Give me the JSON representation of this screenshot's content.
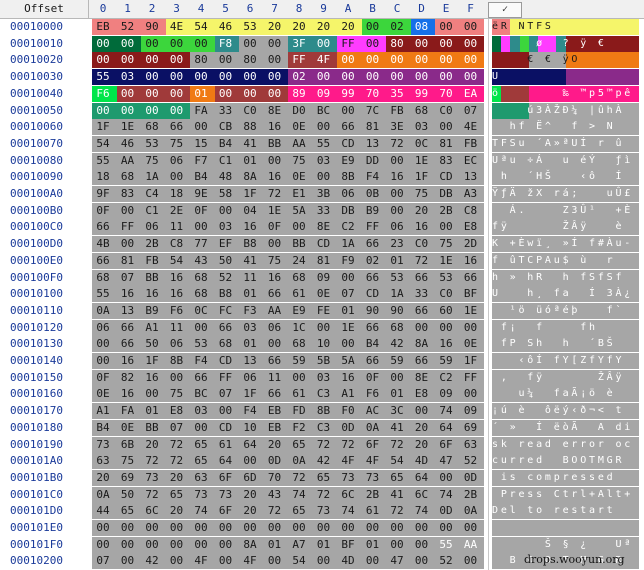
{
  "header": {
    "offset_label": "Offset",
    "columns": [
      "0",
      "1",
      "2",
      "3",
      "4",
      "5",
      "6",
      "7",
      "8",
      "9",
      "A",
      "B",
      "C",
      "D",
      "E",
      "F"
    ],
    "text_icon": "checkmark-icon"
  },
  "colors": {
    "default": "#a6a6a6",
    "red": "#f08080",
    "yellow": "#f5f56a",
    "green": "#3cd63c",
    "blue": "#1670e8",
    "darkgreen": "#006b3a",
    "teal": "#2e8b8b",
    "magenta": "#ff3cff",
    "maroon": "#8a1a1a",
    "brown": "#a03a3a",
    "orange": "#f07a14",
    "purple": "#8a2a8a",
    "navy": "#0a1064",
    "lime": "#00e64a",
    "pink": "#ff1a8a",
    "sea": "#1e9a6e"
  },
  "rows": [
    {
      "offset": "00010000",
      "hex": [
        "EB",
        "52",
        "90",
        "4E",
        "54",
        "46",
        "53",
        "20",
        "20",
        "20",
        "20",
        "00",
        "02",
        "08",
        "00",
        "00"
      ],
      "ascii": "ëR NTFS         "
    },
    {
      "offset": "00010010",
      "hex": [
        "00",
        "00",
        "00",
        "00",
        "00",
        "F8",
        "00",
        "00",
        "3F",
        "00",
        "FF",
        "00",
        "80",
        "00",
        "00",
        "00"
      ],
      "ascii": "     ø  ? ÿ €   "
    },
    {
      "offset": "00010020",
      "hex": [
        "00",
        "00",
        "00",
        "00",
        "80",
        "00",
        "80",
        "00",
        "FF",
        "4F",
        "00",
        "00",
        "00",
        "00",
        "00",
        "00"
      ],
      "ascii": "    € € ÿO      "
    },
    {
      "offset": "00010030",
      "hex": [
        "55",
        "03",
        "00",
        "00",
        "00",
        "00",
        "00",
        "00",
        "02",
        "00",
        "00",
        "00",
        "00",
        "00",
        "00",
        "00"
      ],
      "ascii": "U               "
    },
    {
      "offset": "00010040",
      "hex": [
        "F6",
        "00",
        "00",
        "00",
        "01",
        "00",
        "00",
        "00",
        "89",
        "09",
        "99",
        "70",
        "35",
        "99",
        "70",
        "EA"
      ],
      "ascii": "ö       ‰ ™p5™pê"
    },
    {
      "offset": "00010050",
      "hex": [
        "00",
        "00",
        "00",
        "00",
        "FA",
        "33",
        "C0",
        "8E",
        "D0",
        "BC",
        "00",
        "7C",
        "FB",
        "68",
        "C0",
        "07"
      ],
      "ascii": "    ú3ÀŽÐ¼ |ûhÀ "
    },
    {
      "offset": "00010060",
      "hex": [
        "1F",
        "1E",
        "68",
        "66",
        "00",
        "CB",
        "88",
        "16",
        "0E",
        "00",
        "66",
        "81",
        "3E",
        "03",
        "00",
        "4E"
      ],
      "ascii": "  hf Ë^  f > N"
    },
    {
      "offset": "00010070",
      "hex": [
        "54",
        "46",
        "53",
        "75",
        "15",
        "B4",
        "41",
        "BB",
        "AA",
        "55",
        "CD",
        "13",
        "72",
        "0C",
        "81",
        "FB"
      ],
      "ascii": "TFSu ´A»ªUÍ r û"
    },
    {
      "offset": "00010080",
      "hex": [
        "55",
        "AA",
        "75",
        "06",
        "F7",
        "C1",
        "01",
        "00",
        "75",
        "03",
        "E9",
        "DD",
        "00",
        "1E",
        "83",
        "EC"
      ],
      "ascii": "Uªu ÷Á  u éÝ  ƒì"
    },
    {
      "offset": "00010090",
      "hex": [
        "18",
        "68",
        "1A",
        "00",
        "B4",
        "48",
        "8A",
        "16",
        "0E",
        "00",
        "8B",
        "F4",
        "16",
        "1F",
        "CD",
        "13"
      ],
      "ascii": " h  ´HŠ   ‹ô  Í"
    },
    {
      "offset": "000100A0",
      "hex": [
        "9F",
        "83",
        "C4",
        "18",
        "9E",
        "58",
        "1F",
        "72",
        "E1",
        "3B",
        "06",
        "0B",
        "00",
        "75",
        "DB",
        "A3"
      ],
      "ascii": "ŸƒÄ žX rá;   uÛ£"
    },
    {
      "offset": "000100B0",
      "hex": [
        "0F",
        "00",
        "C1",
        "2E",
        "0F",
        "00",
        "04",
        "1E",
        "5A",
        "33",
        "DB",
        "B9",
        "00",
        "20",
        "2B",
        "C8"
      ],
      "ascii": "  Á.    Z3Û¹  +È"
    },
    {
      "offset": "000100C0",
      "hex": [
        "66",
        "FF",
        "06",
        "11",
        "00",
        "03",
        "16",
        "0F",
        "00",
        "8E",
        "C2",
        "FF",
        "06",
        "16",
        "00",
        "E8"
      ],
      "ascii": "fÿ      ŽÂÿ   è"
    },
    {
      "offset": "000100D0",
      "hex": [
        "4B",
        "00",
        "2B",
        "C8",
        "77",
        "EF",
        "B8",
        "00",
        "BB",
        "CD",
        "1A",
        "66",
        "23",
        "C0",
        "75",
        "2D"
      ],
      "ascii": "K +Èwï¸ »Í f#Àu-"
    },
    {
      "offset": "000100E0",
      "hex": [
        "66",
        "81",
        "FB",
        "54",
        "43",
        "50",
        "41",
        "75",
        "24",
        "81",
        "F9",
        "02",
        "01",
        "72",
        "1E",
        "16"
      ],
      "ascii": "f ûTCPAu$ ù  r  "
    },
    {
      "offset": "000100F0",
      "hex": [
        "68",
        "07",
        "BB",
        "16",
        "68",
        "52",
        "11",
        "16",
        "68",
        "09",
        "00",
        "66",
        "53",
        "66",
        "53",
        "66"
      ],
      "ascii": "h » hR  h fSfSf"
    },
    {
      "offset": "00010100",
      "hex": [
        "55",
        "16",
        "16",
        "16",
        "68",
        "B8",
        "01",
        "66",
        "61",
        "0E",
        "07",
        "CD",
        "1A",
        "33",
        "C0",
        "BF"
      ],
      "ascii": "U   h¸ fa  Í 3À¿"
    },
    {
      "offset": "00010110",
      "hex": [
        "0A",
        "13",
        "B9",
        "F6",
        "0C",
        "FC",
        "F3",
        "AA",
        "E9",
        "FE",
        "01",
        "90",
        "90",
        "66",
        "60",
        "1E"
      ],
      "ascii": "  ¹ö üóªéþ   f` "
    },
    {
      "offset": "00010120",
      "hex": [
        "06",
        "66",
        "A1",
        "11",
        "00",
        "66",
        "03",
        "06",
        "1C",
        "00",
        "1E",
        "66",
        "68",
        "00",
        "00",
        "00"
      ],
      "ascii": " f¡  f    fh   "
    },
    {
      "offset": "00010130",
      "hex": [
        "00",
        "66",
        "50",
        "06",
        "53",
        "68",
        "01",
        "00",
        "68",
        "10",
        "00",
        "B4",
        "42",
        "8A",
        "16",
        "0E"
      ],
      "ascii": " fP Sh  h  ´BŠ  "
    },
    {
      "offset": "00010140",
      "hex": [
        "00",
        "16",
        "1F",
        "8B",
        "F4",
        "CD",
        "13",
        "66",
        "59",
        "5B",
        "5A",
        "66",
        "59",
        "66",
        "59",
        "1F"
      ],
      "ascii": "   ‹ôÍ fY[ZfYfY "
    },
    {
      "offset": "00010150",
      "hex": [
        "0F",
        "82",
        "16",
        "00",
        "66",
        "FF",
        "06",
        "11",
        "00",
        "03",
        "16",
        "0F",
        "00",
        "8E",
        "C2",
        "FF"
      ],
      "ascii": " ‚  fÿ      ŽÂÿ"
    },
    {
      "offset": "00010160",
      "hex": [
        "0E",
        "16",
        "00",
        "75",
        "BC",
        "07",
        "1F",
        "66",
        "61",
        "C3",
        "A1",
        "F6",
        "01",
        "E8",
        "09",
        "00"
      ],
      "ascii": "   u¼  faÃ¡ö è  "
    },
    {
      "offset": "00010170",
      "hex": [
        "A1",
        "FA",
        "01",
        "E8",
        "03",
        "00",
        "F4",
        "EB",
        "FD",
        "8B",
        "F0",
        "AC",
        "3C",
        "00",
        "74",
        "09"
      ],
      "ascii": "¡ú è  ôëý‹ð¬< t "
    },
    {
      "offset": "00010180",
      "hex": [
        "B4",
        "0E",
        "BB",
        "07",
        "00",
        "CD",
        "10",
        "EB",
        "F2",
        "C3",
        "0D",
        "0A",
        "41",
        "20",
        "64",
        "69"
      ],
      "ascii": "´ »  Í ëòÃ  A di"
    },
    {
      "offset": "00010190",
      "hex": [
        "73",
        "6B",
        "20",
        "72",
        "65",
        "61",
        "64",
        "20",
        "65",
        "72",
        "72",
        "6F",
        "72",
        "20",
        "6F",
        "63"
      ],
      "ascii": "sk read error oc"
    },
    {
      "offset": "000101A0",
      "hex": [
        "63",
        "75",
        "72",
        "72",
        "65",
        "64",
        "00",
        "0D",
        "0A",
        "42",
        "4F",
        "4F",
        "54",
        "4D",
        "47",
        "52"
      ],
      "ascii": "curred  BOOTMGR"
    },
    {
      "offset": "000101B0",
      "hex": [
        "20",
        "69",
        "73",
        "20",
        "63",
        "6F",
        "6D",
        "70",
        "72",
        "65",
        "73",
        "73",
        "65",
        "64",
        "00",
        "0D"
      ],
      "ascii": " is compressed "
    },
    {
      "offset": "000101C0",
      "hex": [
        "0A",
        "50",
        "72",
        "65",
        "73",
        "73",
        "20",
        "43",
        "74",
        "72",
        "6C",
        "2B",
        "41",
        "6C",
        "74",
        "2B"
      ],
      "ascii": " Press Ctrl+Alt+"
    },
    {
      "offset": "000101D0",
      "hex": [
        "44",
        "65",
        "6C",
        "20",
        "74",
        "6F",
        "20",
        "72",
        "65",
        "73",
        "74",
        "61",
        "72",
        "74",
        "0D",
        "0A"
      ],
      "ascii": "Del to restart  "
    },
    {
      "offset": "000101E0",
      "hex": [
        "00",
        "00",
        "00",
        "00",
        "00",
        "00",
        "00",
        "00",
        "00",
        "00",
        "00",
        "00",
        "00",
        "00",
        "00",
        "00"
      ],
      "ascii": "                "
    },
    {
      "offset": "000101F0",
      "hex": [
        "00",
        "00",
        "00",
        "00",
        "00",
        "00",
        "8A",
        "01",
        "A7",
        "01",
        "BF",
        "01",
        "00",
        "00",
        "55",
        "AA"
      ],
      "ascii": "      Š § ¿   Uª"
    },
    {
      "offset": "00010200",
      "hex": [
        "07",
        "00",
        "42",
        "00",
        "4F",
        "00",
        "4F",
        "00",
        "54",
        "00",
        "4D",
        "00",
        "47",
        "00",
        "52",
        "00"
      ],
      "ascii": "  B O O T M G R "
    }
  ],
  "watermark": "drops.wooyun.org"
}
